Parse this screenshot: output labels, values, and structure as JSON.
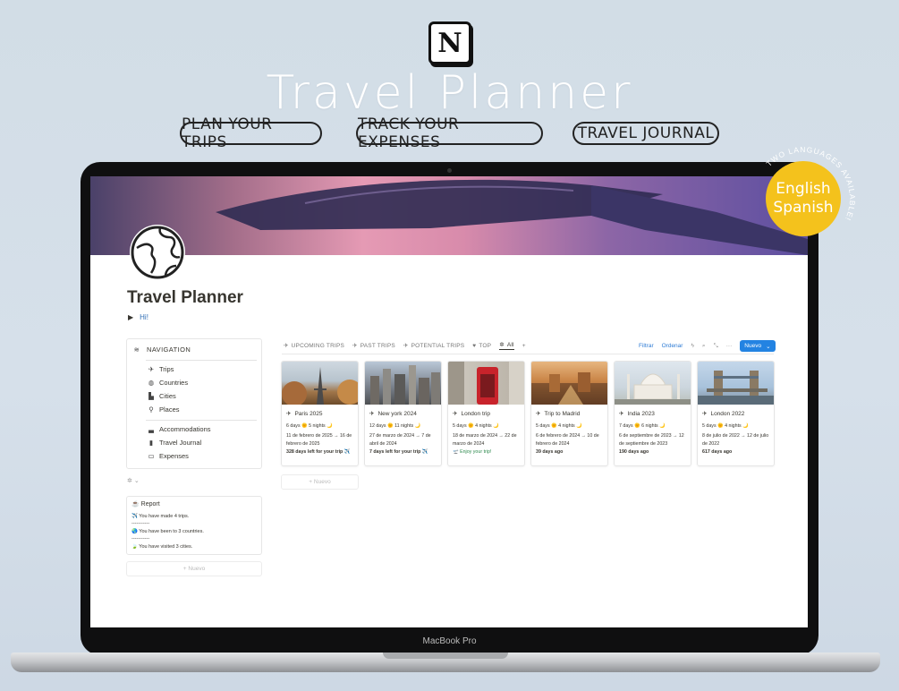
{
  "hero": {
    "logo_letter": "N",
    "title": "Travel Planner",
    "pills": [
      "PLAN YOUR TRIPS",
      "TRACK YOUR EXPENSES",
      "TRAVEL JOURNAL"
    ]
  },
  "badge": {
    "line1": "English",
    "line2": "Spanish",
    "ring_text": "TWO LANGUAGES AVAILABLE!"
  },
  "laptop": {
    "brand": "MacBook Pro"
  },
  "page": {
    "title": "Travel Planner",
    "toggle_label": "Hi!"
  },
  "navigation": {
    "header": "NAVIGATION",
    "items": [
      {
        "label": "Trips",
        "icon": "plane-icon"
      },
      {
        "label": "Countries",
        "icon": "globe-icon"
      },
      {
        "label": "Cities",
        "icon": "city-icon"
      },
      {
        "label": "Places",
        "icon": "pin-icon"
      },
      {
        "label": "Accommodations",
        "icon": "bed-icon"
      },
      {
        "label": "Travel Journal",
        "icon": "book-icon"
      },
      {
        "label": "Expenses",
        "icon": "money-icon"
      }
    ]
  },
  "report": {
    "title": "Report",
    "lines": [
      "✈️ You have made 4 trips.",
      "-----------",
      "🌏 You have been to 3 countries.",
      "-----------",
      "🍃 You have visited 3 cities."
    ]
  },
  "new_label": "Nuevo",
  "tabs": [
    {
      "label": "UPCOMING TRIPS",
      "icon": "plane-up-icon"
    },
    {
      "label": "PAST TRIPS",
      "icon": "plane-down-icon"
    },
    {
      "label": "POTENTIAL TRIPS",
      "icon": "plane-icon"
    },
    {
      "label": "TOP",
      "icon": "heart-icon"
    },
    {
      "label": "All",
      "icon": "sparkle-icon"
    }
  ],
  "toolbar": {
    "filter": "Filtrar",
    "sort": "Ordenar",
    "new_button": "Nuevo"
  },
  "trips": [
    {
      "name": "Paris 2025",
      "duration": "6 days 🌞 5 nights 🌙",
      "dates": "11 de febrero de 2025 → 16 de febrero de 2025",
      "status": "328 days left for your trip ✈️",
      "status_type": "future"
    },
    {
      "name": "New york 2024",
      "duration": "12 days 🌞 11 nights 🌙",
      "dates": "27 de marzo de 2024 → 7 de abril de 2024",
      "status": "7 days left for your trip ✈️",
      "status_type": "future"
    },
    {
      "name": "London trip",
      "duration": "5 days 🌞 4 nights 🌙",
      "dates": "18 de marzo de 2024 → 22 de marzo de 2024",
      "status": "🛫 Enjoy your trip!",
      "status_type": "current"
    },
    {
      "name": "Trip to Madrid",
      "duration": "5 days 🌞 4 nights 🌙",
      "dates": "6 de febrero de 2024 → 10 de febrero de 2024",
      "status": "39 days ago",
      "status_type": "past"
    },
    {
      "name": "India 2023",
      "duration": "7 days 🌞 6 nights 🌙",
      "dates": "6 de septiembre de 2023 → 12 de septiembre de 2023",
      "status": "190 days ago",
      "status_type": "past"
    },
    {
      "name": "London 2022",
      "duration": "5 days 🌞 4 nights 🌙",
      "dates": "8 de julio de 2022 → 12 de julio de 2022",
      "status": "617 days ago",
      "status_type": "past"
    }
  ]
}
